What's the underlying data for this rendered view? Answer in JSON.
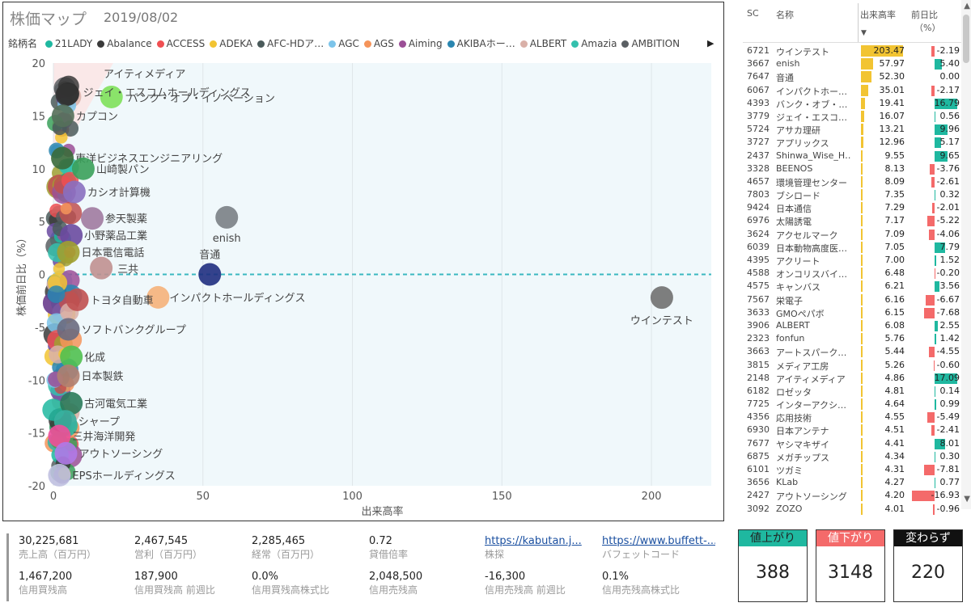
{
  "chart": {
    "title": "株価マップ",
    "date": "2019/08/02",
    "legend_title": "銘柄名",
    "legend": [
      {
        "label": "21LADY",
        "color": "#1fb8a0"
      },
      {
        "label": "Abalance",
        "color": "#3a3a3a"
      },
      {
        "label": "ACCESS",
        "color": "#f04f52"
      },
      {
        "label": "ADEKA",
        "color": "#f2c432"
      },
      {
        "label": "AFC-HDア…",
        "color": "#4a5a5a"
      },
      {
        "label": "AGC",
        "color": "#7cc4ea"
      },
      {
        "label": "AGS",
        "color": "#f5945a"
      },
      {
        "label": "Aiming",
        "color": "#9b4f96"
      },
      {
        "label": "AKIBAホー…",
        "color": "#2a86b0"
      },
      {
        "label": "ALBERT",
        "color": "#d9b0a8"
      },
      {
        "label": "Amazia",
        "color": "#34c0ad"
      },
      {
        "label": "AMBITION",
        "color": "#5a5f63"
      }
    ],
    "legend_next": "▶"
  },
  "chart_data": {
    "type": "scatter",
    "xlabel": "出来高率",
    "ylabel": "株価前日比（%）",
    "xlim": [
      0,
      220
    ],
    "ylim": [
      -20,
      20
    ],
    "xticks": [
      0,
      50,
      100,
      150,
      200
    ],
    "yticks": [
      -20,
      -15,
      -10,
      -5,
      0,
      5,
      10,
      15,
      20
    ],
    "labeled_points": [
      {
        "label": "ウインテスト",
        "x": 203.47,
        "y": -2.19,
        "color": "#707070"
      },
      {
        "label": "enish",
        "x": 57.97,
        "y": 5.4,
        "color": "#7a7f85"
      },
      {
        "label": "音通",
        "x": 52.3,
        "y": 0.0,
        "color": "#1f2d80"
      },
      {
        "label": "インパクトホールディングス",
        "x": 35.01,
        "y": -2.17,
        "color": "#f5b17a"
      },
      {
        "label": "バンク・オブ・イノベーション",
        "x": 19.41,
        "y": 16.79,
        "color": "#7ee05a"
      },
      {
        "label": "アイティメディア",
        "x": 4.86,
        "y": 17.09,
        "color": "#2f2f2f"
      },
      {
        "label": "ジェイ・エスコムホールディングス",
        "x": 4.5,
        "y": 17.0,
        "color": "#333333"
      },
      {
        "label": "カプコン",
        "x": 3.2,
        "y": 15.0,
        "color": "#55705a"
      },
      {
        "label": "東洋ビジネスエンジニアリング",
        "x": 3.0,
        "y": 11.0,
        "color": "#3a6a3a"
      },
      {
        "label": "山崎製パン",
        "x": 10.0,
        "y": 10.0,
        "color": "#3aa05a"
      },
      {
        "label": "カシオ計算機",
        "x": 7.0,
        "y": 7.8,
        "color": "#8a6fc0"
      },
      {
        "label": "参天製薬",
        "x": 13.0,
        "y": 5.3,
        "color": "#a07aa0"
      },
      {
        "label": "小野薬品工業",
        "x": 6.0,
        "y": 3.7,
        "color": "#6a4aa0"
      },
      {
        "label": "日本電信電話",
        "x": 5.0,
        "y": 2.1,
        "color": "#a0a030"
      },
      {
        "label": "三共",
        "x": 16.0,
        "y": 0.6,
        "color": "#c09090"
      },
      {
        "label": "トヨタ自動車",
        "x": 8.0,
        "y": -2.4,
        "color": "#c05050"
      },
      {
        "label": "ソフトバンクグループ",
        "x": 5.0,
        "y": -5.2,
        "color": "#6a6a80"
      },
      {
        "label": "化成",
        "x": 6.0,
        "y": -7.8,
        "color": "#50c050"
      },
      {
        "label": "日本製鉄",
        "x": 5.0,
        "y": -9.6,
        "color": "#b08070"
      },
      {
        "label": "古河電気工業",
        "x": 6.0,
        "y": -12.2,
        "color": "#2a7a5a"
      },
      {
        "label": "シャープ",
        "x": 4.0,
        "y": -13.9,
        "color": "#3ab0a0"
      },
      {
        "label": "三井海洋開発",
        "x": 2.0,
        "y": -15.3,
        "color": "#f04f9a"
      },
      {
        "label": "アウトソーシング",
        "x": 4.2,
        "y": -16.93,
        "color": "#b07ae8"
      },
      {
        "label": "EPSホールディングス",
        "x": 2.0,
        "y": -19.0,
        "color": "#c0c0e0"
      }
    ],
    "reference_line_y": 0
  },
  "table": {
    "headers": {
      "sc": "SC",
      "name": "名称",
      "vol": "出来高率",
      "chg": "前日比",
      "chg_unit": "（%）"
    },
    "rows": [
      {
        "sc": "6721",
        "name": "ウインテスト",
        "vol": "203.47",
        "chg": "-2.19"
      },
      {
        "sc": "3667",
        "name": "enish",
        "vol": "57.97",
        "chg": "5.40"
      },
      {
        "sc": "7647",
        "name": "音通",
        "vol": "52.30",
        "chg": "0.00"
      },
      {
        "sc": "6067",
        "name": "インパクトホー…",
        "vol": "35.01",
        "chg": "-2.17"
      },
      {
        "sc": "4393",
        "name": "バンク・オブ・…",
        "vol": "19.41",
        "chg": "16.79"
      },
      {
        "sc": "3779",
        "name": "ジェイ・エスコ…",
        "vol": "16.07",
        "chg": "0.56"
      },
      {
        "sc": "5724",
        "name": "アサカ理研",
        "vol": "13.21",
        "chg": "9.96"
      },
      {
        "sc": "3727",
        "name": "アプリックス",
        "vol": "12.96",
        "chg": "5.17"
      },
      {
        "sc": "2437",
        "name": "Shinwa_Wise_H…",
        "vol": "9.55",
        "chg": "9.65"
      },
      {
        "sc": "3328",
        "name": "BEENOS",
        "vol": "8.13",
        "chg": "-3.76"
      },
      {
        "sc": "4657",
        "name": "環境管理センター",
        "vol": "8.09",
        "chg": "-2.61"
      },
      {
        "sc": "7803",
        "name": "ブシロード",
        "vol": "7.35",
        "chg": "0.32"
      },
      {
        "sc": "9424",
        "name": "日本通信",
        "vol": "7.29",
        "chg": "-2.01"
      },
      {
        "sc": "6976",
        "name": "太陽誘電",
        "vol": "7.17",
        "chg": "-5.22"
      },
      {
        "sc": "3624",
        "name": "アクセルマーク",
        "vol": "7.09",
        "chg": "-4.06"
      },
      {
        "sc": "6039",
        "name": "日本動物高度医…",
        "vol": "7.05",
        "chg": "7.79"
      },
      {
        "sc": "4395",
        "name": "アクリート",
        "vol": "7.00",
        "chg": "1.52"
      },
      {
        "sc": "4588",
        "name": "オンコリスバイ…",
        "vol": "6.48",
        "chg": "-0.20"
      },
      {
        "sc": "4575",
        "name": "キャンバス",
        "vol": "6.21",
        "chg": "3.56"
      },
      {
        "sc": "7567",
        "name": "栄電子",
        "vol": "6.16",
        "chg": "-6.67"
      },
      {
        "sc": "3633",
        "name": "GMOペパボ",
        "vol": "6.15",
        "chg": "-7.68"
      },
      {
        "sc": "3906",
        "name": "ALBERT",
        "vol": "6.08",
        "chg": "2.55"
      },
      {
        "sc": "2323",
        "name": "fonfun",
        "vol": "5.76",
        "chg": "1.42"
      },
      {
        "sc": "3663",
        "name": "アートスパーク…",
        "vol": "5.44",
        "chg": "-4.55"
      },
      {
        "sc": "3815",
        "name": "メディア工房",
        "vol": "5.26",
        "chg": "-0.60"
      },
      {
        "sc": "2148",
        "name": "アイティメディア",
        "vol": "4.86",
        "chg": "17.09"
      },
      {
        "sc": "6182",
        "name": "ロゼッタ",
        "vol": "4.81",
        "chg": "0.14"
      },
      {
        "sc": "7725",
        "name": "インターアクシ…",
        "vol": "4.64",
        "chg": "0.99"
      },
      {
        "sc": "4356",
        "name": "応用技術",
        "vol": "4.55",
        "chg": "-5.49"
      },
      {
        "sc": "6930",
        "name": "日本アンテナ",
        "vol": "4.51",
        "chg": "-2.41"
      },
      {
        "sc": "7677",
        "name": "ヤシマキザイ",
        "vol": "4.41",
        "chg": "8.01"
      },
      {
        "sc": "6875",
        "name": "メガチップス",
        "vol": "4.34",
        "chg": "0.30"
      },
      {
        "sc": "6101",
        "name": "ツガミ",
        "vol": "4.31",
        "chg": "-7.81"
      },
      {
        "sc": "3656",
        "name": "KLab",
        "vol": "4.27",
        "chg": "0.77"
      },
      {
        "sc": "2427",
        "name": "アウトソーシング",
        "vol": "4.20",
        "chg": "-16.93"
      },
      {
        "sc": "3092",
        "name": "ZOZO",
        "vol": "4.01",
        "chg": "-0.96"
      }
    ]
  },
  "stats": [
    {
      "value": "30,225,681",
      "label": "売上高（百万円）"
    },
    {
      "value": "2,467,545",
      "label": "営利（百万円）"
    },
    {
      "value": "2,285,465",
      "label": "経常（百万円）"
    },
    {
      "value": "0.72",
      "label": "貸借倍率"
    },
    {
      "value": "https://kabutan.j...",
      "label": "株探",
      "link": true
    },
    {
      "value": "https://www.buffett-...",
      "label": "バフェットコード",
      "link": true
    },
    {
      "value": "1,467,200",
      "label": "信用買残高"
    },
    {
      "value": "187,900",
      "label": "信用買残高 前週比"
    },
    {
      "value": "0.0%",
      "label": "信用買残高株式比"
    },
    {
      "value": "2,048,500",
      "label": "信用売残高"
    },
    {
      "value": "-16,300",
      "label": "信用売残高 前週比"
    },
    {
      "value": "0.1%",
      "label": "信用売残高株式比"
    }
  ],
  "cards": [
    {
      "label": "値上がり",
      "value": "388",
      "color": "#1fb8a0",
      "text_color": "#222"
    },
    {
      "label": "値下がり",
      "value": "3148",
      "color": "#f46a6a",
      "text_color": "#fff"
    },
    {
      "label": "変わらず",
      "value": "220",
      "color": "#111111",
      "text_color": "#fff"
    }
  ],
  "colors": {
    "positive_bar": "#1fb8a0",
    "negative_bar": "#f46a6a",
    "volume_bar": "#f2c432",
    "plot_bg": "#f0f8fb",
    "reference_line": "#3ab8c0"
  }
}
